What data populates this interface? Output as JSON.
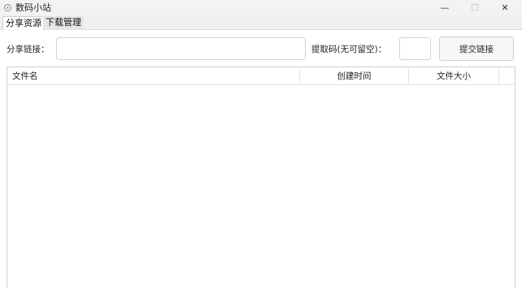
{
  "window": {
    "title": "数码小站",
    "minimize_glyph": "—",
    "maximize_glyph": "☐",
    "close_glyph": "✕"
  },
  "tabs": [
    {
      "label": "分享资源",
      "selected": true
    },
    {
      "label": "下载管理",
      "selected": false
    }
  ],
  "form": {
    "share_link_label": "分享链接：",
    "share_link_value": "",
    "extract_code_label": "提取码(无可留空)：",
    "extract_code_value": "",
    "submit_label": "提交链接"
  },
  "file_list": {
    "columns": [
      "文件名",
      "创建时间",
      "文件大小"
    ],
    "rows": []
  }
}
